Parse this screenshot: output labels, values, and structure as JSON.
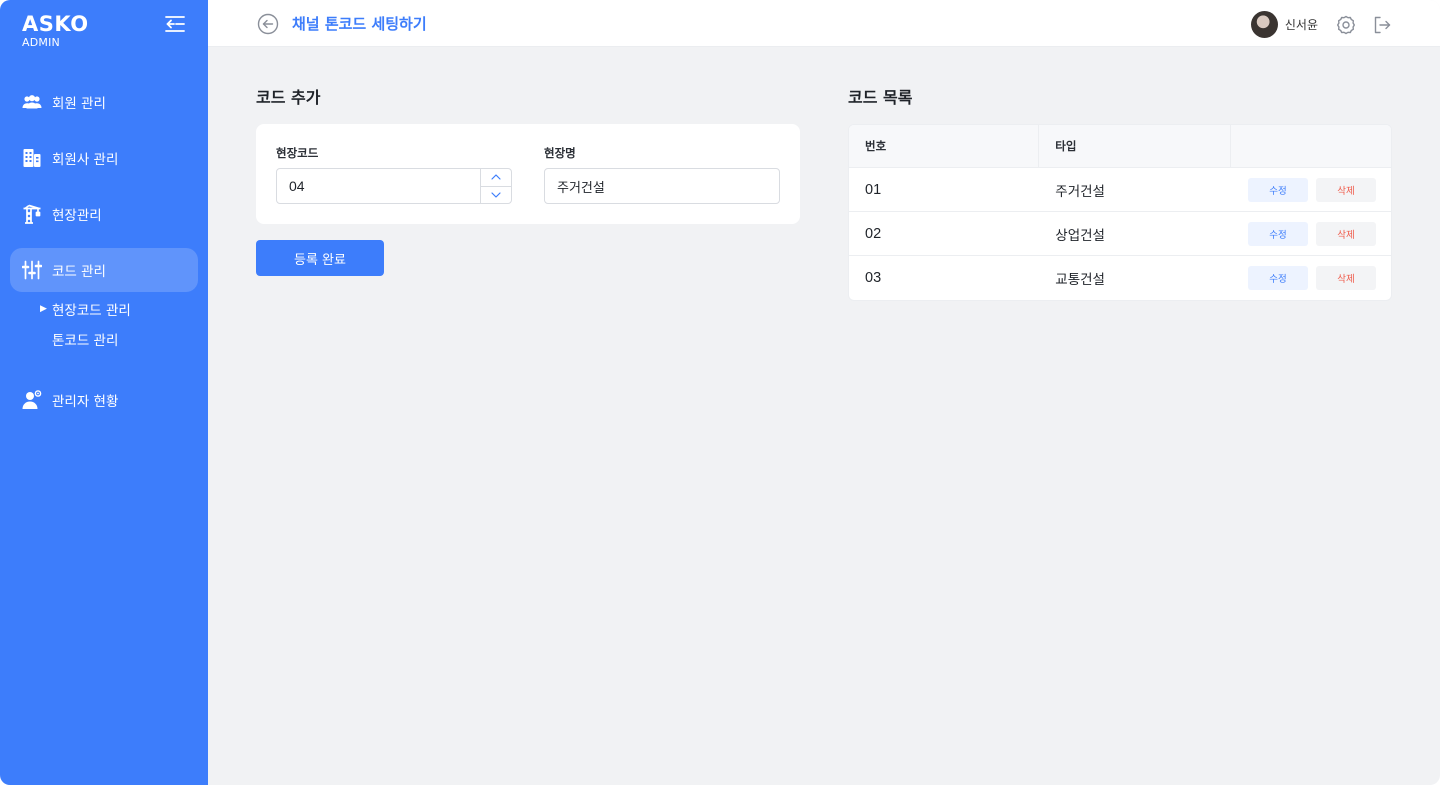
{
  "sidebar": {
    "brand": "ASKO",
    "brand_sub": "ADMIN",
    "items": [
      {
        "label": "회원 관리",
        "icon": "users-icon"
      },
      {
        "label": "회원사 관리",
        "icon": "building-icon"
      },
      {
        "label": "현장관리",
        "icon": "crane-icon"
      },
      {
        "label": "코드 관리",
        "icon": "sliders-icon",
        "active": true
      },
      {
        "label": "관리자 현황",
        "icon": "admin-user-icon"
      }
    ],
    "sub_items": [
      {
        "label": "현장코드 관리",
        "selected": true
      },
      {
        "label": "톤코드 관리",
        "selected": false
      }
    ]
  },
  "header": {
    "title": "채널 톤코드 세팅하기",
    "user_name": "신서윤"
  },
  "form": {
    "title": "코드 추가",
    "code_label": "현장코드",
    "code_value": "04",
    "name_label": "현장명",
    "name_value": "주거건설",
    "submit_label": "등록 완료"
  },
  "list": {
    "title": "코드 목록",
    "columns": [
      "번호",
      "타입",
      ""
    ],
    "rows": [
      {
        "num": "01",
        "type": "주거건설",
        "edit": "수정",
        "delete": "삭제"
      },
      {
        "num": "02",
        "type": "상업건설",
        "edit": "수정",
        "delete": "삭제"
      },
      {
        "num": "03",
        "type": "교통건설",
        "edit": "수정",
        "delete": "삭제"
      }
    ]
  },
  "colors": {
    "primary": "#3d7dfb",
    "danger": "#ef5a4a",
    "background": "#f1f2f4"
  }
}
